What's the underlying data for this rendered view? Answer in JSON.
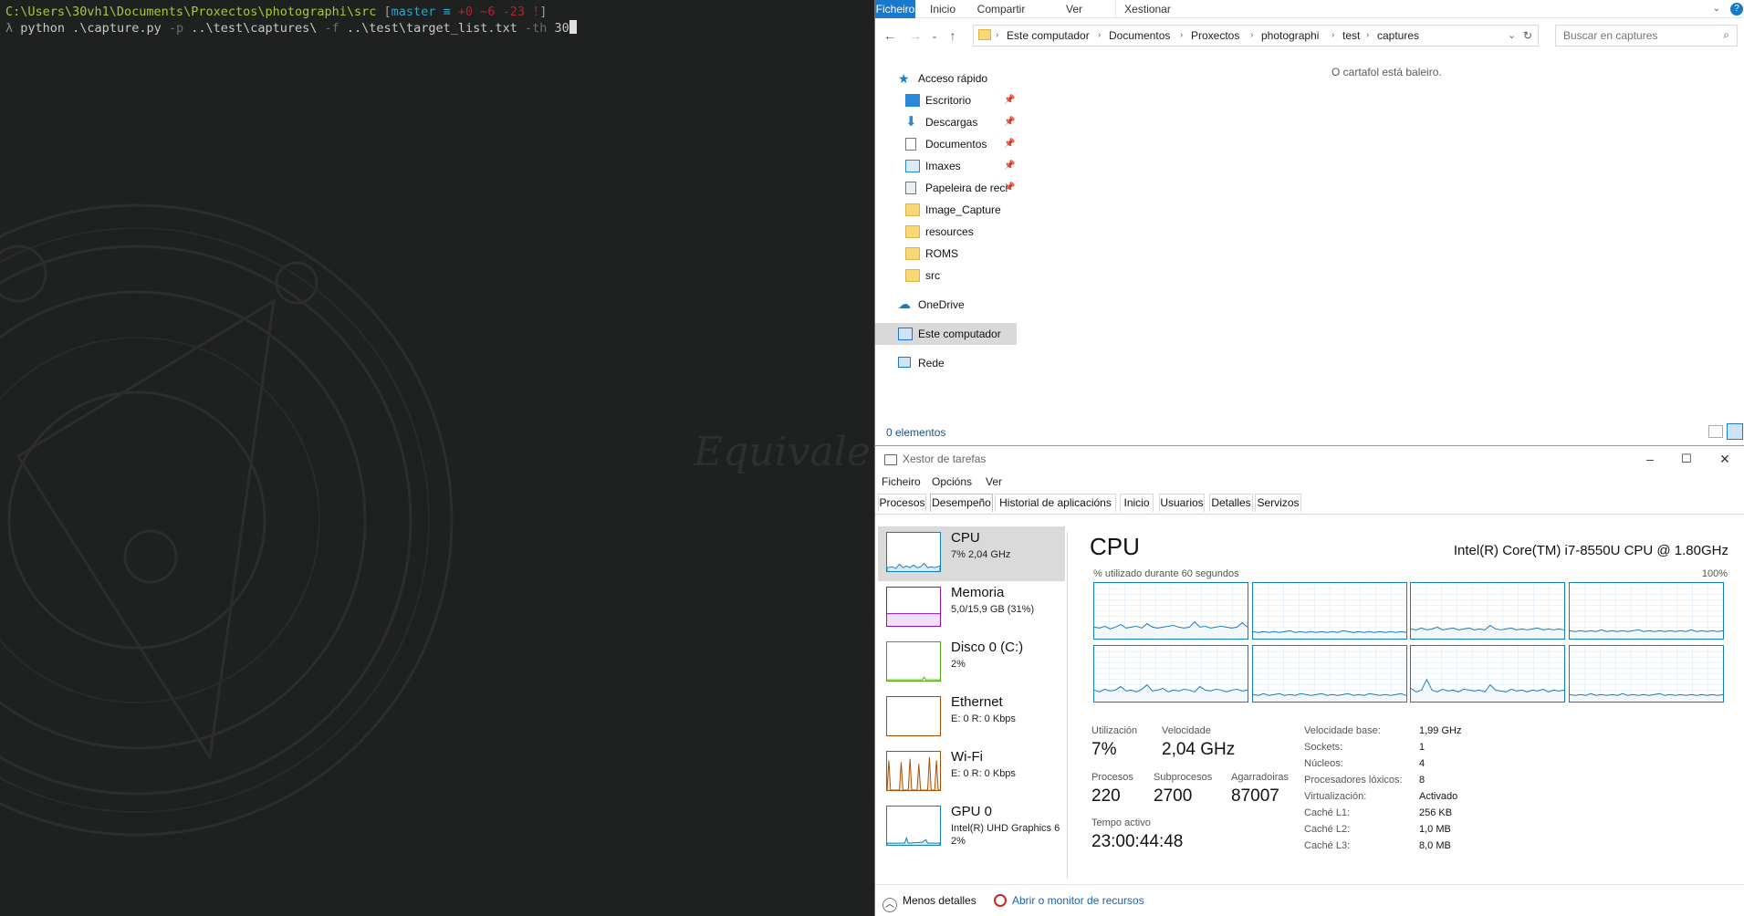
{
  "terminal": {
    "line1_path": "C:\\Users\\30vh1\\Documents\\Proxectos\\photographi\\src",
    "line1_open": " [",
    "line1_branch": "master",
    "line1_eq": " ≡ ",
    "line1_status": "+0 ~6 -23 !",
    "line1_close": "]",
    "prompt_symbol": "λ",
    "command": "python .\\capture.py",
    "arg1": " -p ",
    "path1": "..\\test\\captures\\",
    "arg2": " -f ",
    "path2": "..\\test\\target_list.txt",
    "arg3": " -th ",
    "value3": "30",
    "wallpaper_text": "Equivalent"
  },
  "explorer": {
    "ribbon_tabs": [
      "Ficheiro",
      "Inicio",
      "Compartir",
      "Ver",
      "Xestionar"
    ],
    "breadcrumb": [
      "Este computador",
      "Documentos",
      "Proxectos",
      "photographi",
      "test",
      "captures"
    ],
    "search_placeholder": "Buscar en captures",
    "nav": {
      "quick_access": "Acceso rápido",
      "pinned": [
        "Escritorio",
        "Descargas",
        "Documentos",
        "Imaxes",
        "Papeleira de reci"
      ],
      "folders": [
        "Image_Capture",
        "resources",
        "ROMS",
        "src"
      ],
      "onedrive": "OneDrive",
      "this_pc": "Este computador",
      "network": "Rede"
    },
    "empty_message": "O cartafol está baleiro.",
    "status": "0 elementos"
  },
  "taskmgr": {
    "title": "Xestor de tarefas",
    "menu": [
      "Ficheiro",
      "Opcións",
      "Ver"
    ],
    "tabs": [
      "Procesos",
      "Desempeño",
      "Historial de aplicacións",
      "Inicio",
      "Usuarios",
      "Detalles",
      "Servizos"
    ],
    "resources": [
      {
        "name": "CPU",
        "sub": "7% 2,04 GHz",
        "sub2": ""
      },
      {
        "name": "Memoria",
        "sub": "5,0/15,9 GB (31%)",
        "sub2": ""
      },
      {
        "name": "Disco 0 (C:)",
        "sub": "2%",
        "sub2": ""
      },
      {
        "name": "Ethernet",
        "sub": "E: 0 R: 0 Kbps",
        "sub2": ""
      },
      {
        "name": "Wi-Fi",
        "sub": "E: 0 R: 0 Kbps",
        "sub2": ""
      },
      {
        "name": "GPU 0",
        "sub": "Intel(R) UHD Graphics 6",
        "sub2": "2%"
      }
    ],
    "heading": "CPU",
    "model": "Intel(R) Core(TM) i7-8550U CPU @ 1.80GHz",
    "graph_label": "% utilizado durante 60 segundos",
    "graph_max": "100%",
    "stats": {
      "util_label": "Utilización",
      "util_value": "7%",
      "speed_label": "Velocidade",
      "speed_value": "2,04 GHz",
      "proc_label": "Procesos",
      "proc_value": "220",
      "threads_label": "Subprocesos",
      "threads_value": "2700",
      "handles_label": "Agarradoiras",
      "handles_value": "87007",
      "uptime_label": "Tempo activo",
      "uptime_value": "23:00:44:48"
    },
    "details": [
      {
        "k": "Velocidade base:",
        "v": "1,99 GHz"
      },
      {
        "k": "Sockets:",
        "v": "1"
      },
      {
        "k": "Núcleos:",
        "v": "4"
      },
      {
        "k": "Procesadores lóxicos:",
        "v": "8"
      },
      {
        "k": "Virtualización:",
        "v": "Activado"
      },
      {
        "k": "Caché L1:",
        "v": "256 KB"
      },
      {
        "k": "Caché L2:",
        "v": "1,0 MB"
      },
      {
        "k": "Caché L3:",
        "v": "8,0 MB"
      }
    ],
    "footer_less": "Menos detalles",
    "footer_monitor": "Abrir o monitor de recursos",
    "colors": {
      "cpu": "#117dbb",
      "memory": "#8b12ae",
      "disk": "#4da60c",
      "net": "#a74f01",
      "gpu": "#117dbb"
    }
  }
}
